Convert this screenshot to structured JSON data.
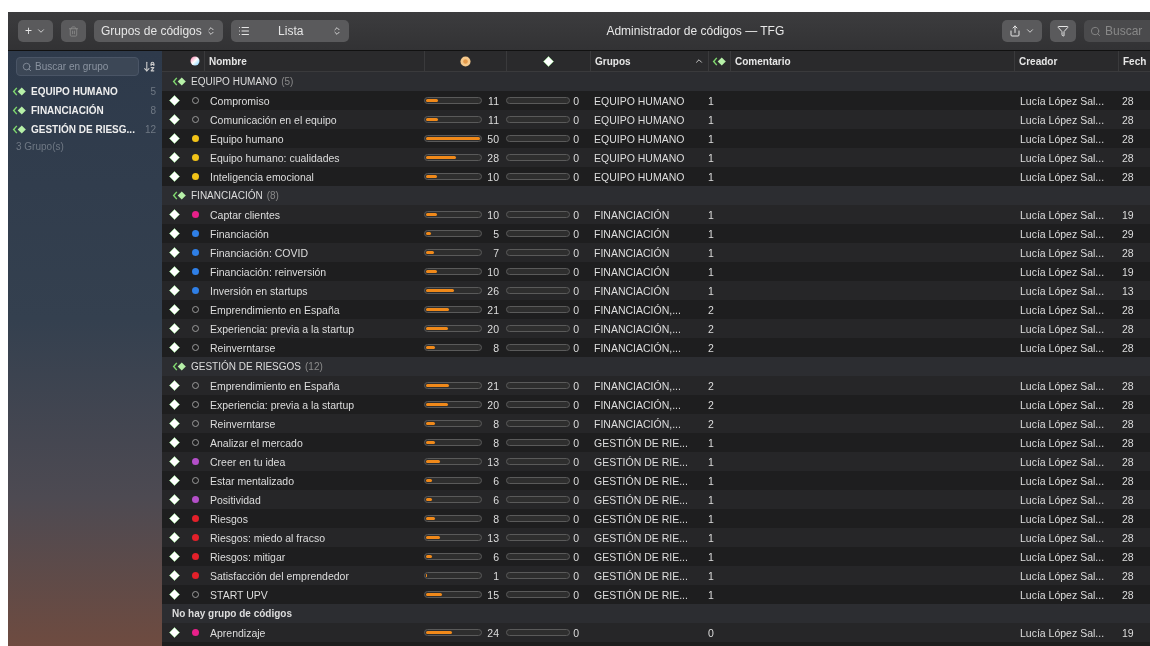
{
  "toolbar": {
    "add_label": "+",
    "scope": "Grupos de códigos",
    "view": "Lista",
    "title": "Administrador de códigos — TFG",
    "search_placeholder": "Buscar"
  },
  "sidebar": {
    "search_placeholder": "Buscar en grupo",
    "items": [
      {
        "name": "EQUIPO HUMANO",
        "count": "5"
      },
      {
        "name": "FINANCIACIÓN",
        "count": "8"
      },
      {
        "name": "GESTIÓN DE RIESG...",
        "count": "12"
      }
    ],
    "footer": "3 Grupo(s)"
  },
  "table": {
    "columns": [
      {
        "kind": "dot"
      },
      {
        "kind": "text",
        "label": "Nombre"
      },
      {
        "kind": "usage"
      },
      {
        "kind": "links"
      },
      {
        "kind": "text",
        "label": "Grupos",
        "sorted": true
      },
      {
        "kind": "groups"
      },
      {
        "kind": "text",
        "label": "Comentario"
      },
      {
        "kind": "text",
        "label": "Creador"
      },
      {
        "kind": "text",
        "label": "Fech"
      }
    ],
    "sections": [
      {
        "kind": "group",
        "name": "EQUIPO HUMANO",
        "count": "(5)",
        "rows": [
          {
            "name": "Compromiso",
            "usage": {
              "level": 0.22,
              "reading": "11"
            },
            "links": "0",
            "groups": "EQUIPO HUMANO",
            "group_count": "1",
            "creator": "Lucía López Sal...",
            "date": "28"
          },
          {
            "name": "Comunicación en el equipo",
            "usage": {
              "level": 0.22,
              "reading": "11"
            },
            "links": "0",
            "groups": "EQUIPO HUMANO",
            "group_count": "1",
            "creator": "Lucía López Sal...",
            "date": "28"
          },
          {
            "name": "Equipo humano",
            "color": "#f2c318",
            "usage": {
              "level": 1,
              "reading": "50"
            },
            "links": "0",
            "groups": "EQUIPO HUMANO",
            "group_count": "1",
            "creator": "Lucía López Sal...",
            "date": "28"
          },
          {
            "name": "Equipo humano: cualidades",
            "color": "#f2c318",
            "usage": {
              "level": 0.56,
              "reading": "28"
            },
            "links": "0",
            "groups": "EQUIPO HUMANO",
            "group_count": "1",
            "creator": "Lucía López Sal...",
            "date": "28"
          },
          {
            "name": "Inteligencia emocional",
            "color": "#f2c318",
            "usage": {
              "level": 0.2,
              "reading": "10"
            },
            "links": "0",
            "groups": "EQUIPO HUMANO",
            "group_count": "1",
            "creator": "Lucía López Sal...",
            "date": "28"
          }
        ]
      },
      {
        "kind": "group",
        "name": "FINANCIACIÓN",
        "count": "(8)",
        "rows": [
          {
            "name": "Captar clientes",
            "color": "#e8208a",
            "usage": {
              "level": 0.2,
              "reading": "10"
            },
            "links": "0",
            "groups": "FINANCIACIÓN",
            "group_count": "1",
            "creator": "Lucía López Sal...",
            "date": "19"
          },
          {
            "name": "Financiación",
            "color": "#2f7fe6",
            "usage": {
              "level": 0.1,
              "reading": "5"
            },
            "links": "0",
            "groups": "FINANCIACIÓN",
            "group_count": "1",
            "creator": "Lucía López Sal...",
            "date": "29"
          },
          {
            "name": "Financiación: COVID",
            "color": "#2f7fe6",
            "usage": {
              "level": 0.14,
              "reading": "7"
            },
            "links": "0",
            "groups": "FINANCIACIÓN",
            "group_count": "1",
            "creator": "Lucía López Sal...",
            "date": "28"
          },
          {
            "name": "Financiación: reinversión",
            "color": "#2f7fe6",
            "usage": {
              "level": 0.2,
              "reading": "10"
            },
            "links": "0",
            "groups": "FINANCIACIÓN",
            "group_count": "1",
            "creator": "Lucía López Sal...",
            "date": "19"
          },
          {
            "name": "Inversión en startups",
            "color": "#2f7fe6",
            "usage": {
              "level": 0.52,
              "reading": "26"
            },
            "links": "0",
            "groups": "FINANCIACIÓN",
            "group_count": "1",
            "creator": "Lucía López Sal...",
            "date": "13"
          },
          {
            "name": "Emprendimiento en España",
            "usage": {
              "level": 0.42,
              "reading": "21"
            },
            "links": "0",
            "groups": "FINANCIACIÓN,...",
            "group_count": "2",
            "creator": "Lucía López Sal...",
            "date": "28"
          },
          {
            "name": "Experiencia: previa a la startup",
            "usage": {
              "level": 0.4,
              "reading": "20"
            },
            "links": "0",
            "groups": "FINANCIACIÓN,...",
            "group_count": "2",
            "creator": "Lucía López Sal...",
            "date": "28"
          },
          {
            "name": "Reinverntarse",
            "usage": {
              "level": 0.16,
              "reading": "8"
            },
            "links": "0",
            "groups": "FINANCIACIÓN,...",
            "group_count": "2",
            "creator": "Lucía López Sal...",
            "date": "28"
          }
        ]
      },
      {
        "kind": "group",
        "name": "GESTIÓN DE RIESGOS",
        "count": "(12)",
        "rows": [
          {
            "name": "Emprendimiento en España",
            "usage": {
              "level": 0.42,
              "reading": "21"
            },
            "links": "0",
            "groups": "FINANCIACIÓN,...",
            "group_count": "2",
            "creator": "Lucía López Sal...",
            "date": "28"
          },
          {
            "name": "Experiencia: previa a la startup",
            "usage": {
              "level": 0.4,
              "reading": "20"
            },
            "links": "0",
            "groups": "FINANCIACIÓN,...",
            "group_count": "2",
            "creator": "Lucía López Sal...",
            "date": "28"
          },
          {
            "name": "Reinverntarse",
            "usage": {
              "level": 0.16,
              "reading": "8"
            },
            "links": "0",
            "groups": "FINANCIACIÓN,...",
            "group_count": "2",
            "creator": "Lucía López Sal...",
            "date": "28"
          },
          {
            "name": "Analizar el mercado",
            "usage": {
              "level": 0.16,
              "reading": "8"
            },
            "links": "0",
            "groups": "GESTIÓN DE RIE...",
            "group_count": "1",
            "creator": "Lucía López Sal...",
            "date": "28"
          },
          {
            "name": "Creer en tu idea",
            "color": "#b44fc9",
            "usage": {
              "level": 0.26,
              "reading": "13"
            },
            "links": "0",
            "groups": "GESTIÓN DE RIE...",
            "group_count": "1",
            "creator": "Lucía López Sal...",
            "date": "28"
          },
          {
            "name": "Estar mentalizado",
            "usage": {
              "level": 0.12,
              "reading": "6"
            },
            "links": "0",
            "groups": "GESTIÓN DE RIE...",
            "group_count": "1",
            "creator": "Lucía López Sal...",
            "date": "28"
          },
          {
            "name": "Positividad",
            "color": "#b44fc9",
            "usage": {
              "level": 0.12,
              "reading": "6"
            },
            "links": "0",
            "groups": "GESTIÓN DE RIE...",
            "group_count": "1",
            "creator": "Lucía López Sal...",
            "date": "28"
          },
          {
            "name": "Riesgos",
            "color": "#e3202a",
            "usage": {
              "level": 0.16,
              "reading": "8"
            },
            "links": "0",
            "groups": "GESTIÓN DE RIE...",
            "group_count": "1",
            "creator": "Lucía López Sal...",
            "date": "28"
          },
          {
            "name": "Riesgos: miedo al fracso",
            "color": "#e3202a",
            "usage": {
              "level": 0.26,
              "reading": "13"
            },
            "links": "0",
            "groups": "GESTIÓN DE RIE...",
            "group_count": "1",
            "creator": "Lucía López Sal...",
            "date": "28"
          },
          {
            "name": "Riesgos: mitigar",
            "color": "#e3202a",
            "usage": {
              "level": 0.12,
              "reading": "6"
            },
            "links": "0",
            "groups": "GESTIÓN DE RIE...",
            "group_count": "1",
            "creator": "Lucía López Sal...",
            "date": "28"
          },
          {
            "name": "Satisfacción del emprendedor",
            "color": "#e3202a",
            "usage": {
              "level": 0.02,
              "reading": "1"
            },
            "links": "0",
            "groups": "GESTIÓN DE RIE...",
            "group_count": "1",
            "creator": "Lucía López Sal...",
            "date": "28"
          },
          {
            "name": "START UPV",
            "usage": {
              "level": 0.3,
              "reading": "15"
            },
            "links": "0",
            "groups": "GESTIÓN DE RIE...",
            "group_count": "1",
            "creator": "Lucía López Sal...",
            "date": "28"
          }
        ]
      },
      {
        "kind": "ungrouped",
        "name": "No hay grupo de códigos",
        "rows": [
          {
            "name": "Aprendizaje",
            "color": "#e8208a",
            "usage": {
              "level": 0.48,
              "reading": "24"
            },
            "links": "0",
            "group_count": "0",
            "creator": "Lucía López Sal...",
            "date": "19"
          }
        ]
      }
    ]
  }
}
